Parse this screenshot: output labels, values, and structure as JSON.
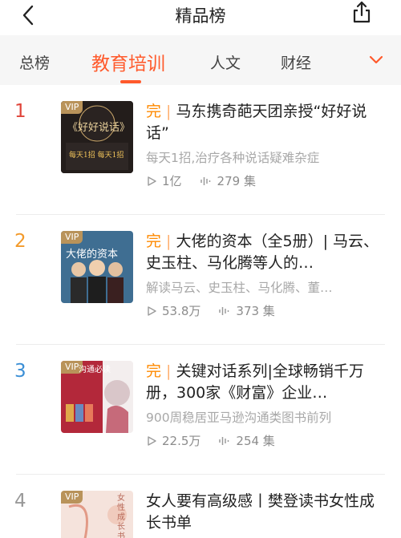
{
  "header": {
    "title": "精品榜",
    "back_icon": "chevron-left-icon",
    "share_icon": "share-icon"
  },
  "tabs": [
    {
      "label": "总榜",
      "active": false
    },
    {
      "label": "教育培训",
      "active": true
    },
    {
      "label": "人文",
      "active": false
    },
    {
      "label": "财经",
      "active": false
    }
  ],
  "dropdown_icon": "chevron-down-icon",
  "colors": {
    "accent": "#ff5a2c",
    "rank_1": "#e0453a",
    "rank_2": "#f39a2a",
    "rank_3": "#3b8fd6",
    "rank_4": "#999999",
    "completed": "#ff8a00",
    "vip_badge": "#b9935a"
  },
  "items": [
    {
      "rank": "1",
      "badge": "完",
      "title": "马东携奇葩天团亲授“好好说话”",
      "desc": "每天1招,治疗各种说话疑难杂症",
      "plays": "1亿",
      "episodes": "279 集",
      "vip": "VIP",
      "cover_text": "《好好说话》",
      "cover_sub": "每天1招 每天1招"
    },
    {
      "rank": "2",
      "badge": "完",
      "title": "大佬的资本（全5册）| 马云、史玉柱、马化腾等人的…",
      "desc": "解读马云、史玉柱、马化腾、董…",
      "plays": "53.8万",
      "episodes": "373 集",
      "vip": "VIP",
      "cover_text": "大佬的资本"
    },
    {
      "rank": "3",
      "badge": "完",
      "title": "关键对话系列|全球畅销千万册，300家《财富》企业…",
      "desc": "900周稳居亚马逊沟通类图书前列",
      "plays": "22.5万",
      "episodes": "254 集",
      "vip": "VIP",
      "cover_text": "沟通必读"
    },
    {
      "rank": "4",
      "badge": "",
      "title": "女人要有高级感丨樊登读书女性成长书单",
      "desc": "",
      "plays": "",
      "episodes": "",
      "vip": "VIP",
      "cover_text": "女性成长书单"
    }
  ]
}
